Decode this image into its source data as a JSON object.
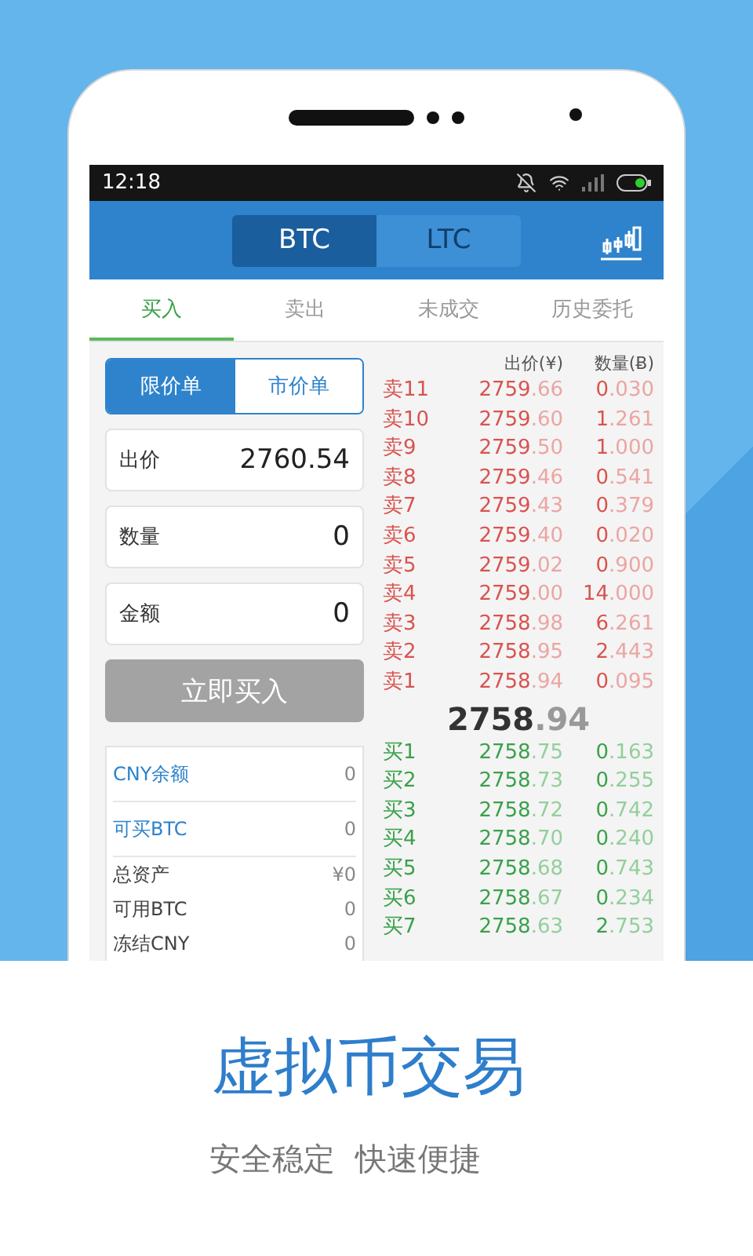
{
  "status_bar": {
    "time": "12:18"
  },
  "coin_tabs": [
    {
      "label": "BTC",
      "selected": true
    },
    {
      "label": "LTC",
      "selected": false
    }
  ],
  "tabs": [
    {
      "label": "买入",
      "selected": true
    },
    {
      "label": "卖出",
      "selected": false
    },
    {
      "label": "未成交",
      "selected": false
    },
    {
      "label": "历史委托",
      "selected": false
    }
  ],
  "order_types": [
    {
      "label": "限价单",
      "selected": true
    },
    {
      "label": "市价单",
      "selected": false
    }
  ],
  "fields": [
    {
      "label": "出价",
      "value": "2760.54"
    },
    {
      "label": "数量",
      "value": "0"
    },
    {
      "label": "金额",
      "value": "0"
    }
  ],
  "submit_button": {
    "label": "立即买入",
    "disabled": true
  },
  "balances": [
    {
      "label": "CNY余额",
      "value": "0",
      "kind": "link"
    },
    {
      "label": "可买BTC",
      "value": "0",
      "kind": "link"
    },
    {
      "label": "总资产",
      "value": "¥0",
      "kind": "plain"
    },
    {
      "label": "可用BTC",
      "value": "0",
      "kind": "plain"
    },
    {
      "label": "冻结CNY",
      "value": "0",
      "kind": "plain"
    }
  ],
  "order_book": {
    "price_header": "出价(¥)",
    "amount_header": "数量(Ƀ)",
    "asks": [
      {
        "label": "卖11",
        "price": "2759.66",
        "amount": "0.030"
      },
      {
        "label": "卖10",
        "price": "2759.60",
        "amount": "1.261"
      },
      {
        "label": "卖9",
        "price": "2759.50",
        "amount": "1.000"
      },
      {
        "label": "卖8",
        "price": "2759.46",
        "amount": "0.541"
      },
      {
        "label": "卖7",
        "price": "2759.43",
        "amount": "0.379"
      },
      {
        "label": "卖6",
        "price": "2759.40",
        "amount": "0.020"
      },
      {
        "label": "卖5",
        "price": "2759.02",
        "amount": "0.900"
      },
      {
        "label": "卖4",
        "price": "2759.00",
        "amount": "14.000"
      },
      {
        "label": "卖3",
        "price": "2758.98",
        "amount": "6.261"
      },
      {
        "label": "卖2",
        "price": "2758.95",
        "amount": "2.443"
      },
      {
        "label": "卖1",
        "price": "2758.94",
        "amount": "0.095"
      }
    ],
    "last_price": "2758.94",
    "bids": [
      {
        "label": "买1",
        "price": "2758.75",
        "amount": "0.163"
      },
      {
        "label": "买2",
        "price": "2758.73",
        "amount": "0.255"
      },
      {
        "label": "买3",
        "price": "2758.72",
        "amount": "0.742"
      },
      {
        "label": "买4",
        "price": "2758.70",
        "amount": "0.240"
      },
      {
        "label": "买5",
        "price": "2758.68",
        "amount": "0.743"
      },
      {
        "label": "买6",
        "price": "2758.67",
        "amount": "0.234"
      },
      {
        "label": "买7",
        "price": "2758.63",
        "amount": "2.753"
      }
    ]
  },
  "promo": {
    "headline": "虚拟币交易",
    "tagline": "安全稳定  快速便捷"
  }
}
